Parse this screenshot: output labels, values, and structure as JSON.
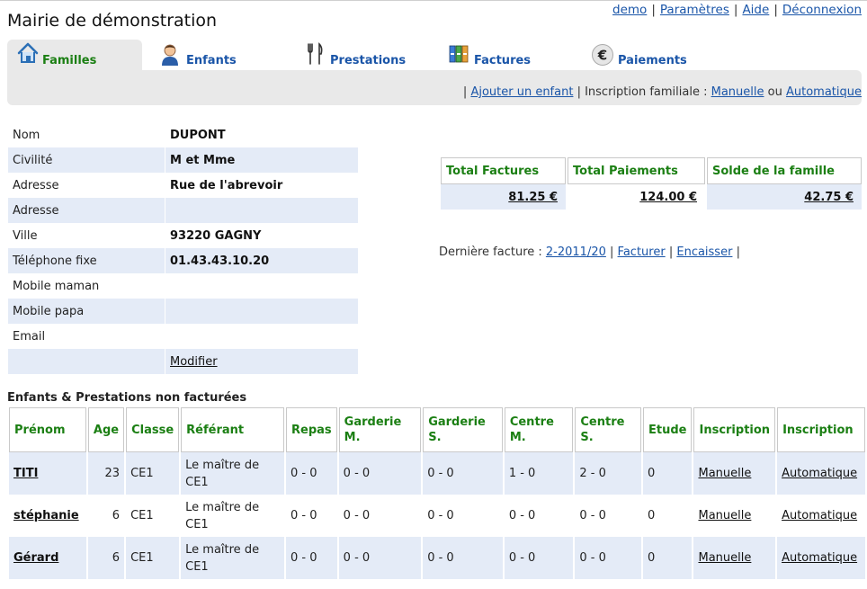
{
  "app": {
    "title": "Mairie de démonstration"
  },
  "top_links": [
    "demo",
    "Paramètres",
    "Aide",
    "Déconnexion"
  ],
  "tabs": [
    {
      "label": "Familles",
      "icon": "house-icon"
    },
    {
      "label": "Enfants",
      "icon": "child-icon"
    },
    {
      "label": "Prestations",
      "icon": "fork-knife-icon"
    },
    {
      "label": "Factures",
      "icon": "binders-icon"
    },
    {
      "label": "Paiements",
      "icon": "euro-icon"
    }
  ],
  "subbar": {
    "sep": "|",
    "add_child": "Ajouter un enfant",
    "family_signup": "| Inscription familiale :",
    "manual": "Manuelle",
    "or": "ou",
    "auto": "Automatique"
  },
  "family": {
    "rows": [
      {
        "label": "Nom",
        "value": "DUPONT"
      },
      {
        "label": "Civilité",
        "value": "M et Mme"
      },
      {
        "label": "Adresse",
        "value": "Rue de l'abrevoir"
      },
      {
        "label": "Adresse",
        "value": ""
      },
      {
        "label": "Ville",
        "value": "93220 GAGNY"
      },
      {
        "label": "Téléphone fixe",
        "value": "01.43.43.10.20"
      },
      {
        "label": "Mobile maman",
        "value": ""
      },
      {
        "label": "Mobile papa",
        "value": ""
      },
      {
        "label": "Email",
        "value": ""
      }
    ],
    "modify": "Modifier"
  },
  "totals": {
    "headers": [
      "Total Factures",
      "Total Paiements",
      "Solde de la famille"
    ],
    "values": [
      "81.25 €",
      "124.00 €",
      "42.75 €"
    ]
  },
  "last_invoice": {
    "label": "Dernière facture :",
    "number": "2-2011/20",
    "bill": "Facturer",
    "collect": "Encaisser",
    "sep": "|"
  },
  "children_section": {
    "title": "Enfants & Prestations non facturées",
    "headers": [
      "Prénom",
      "Age",
      "Classe",
      "Référant",
      "Repas",
      "Garderie M.",
      "Garderie S.",
      "Centre M.",
      "Centre S.",
      "Etude",
      "Inscription",
      "Inscription"
    ],
    "rows": [
      {
        "prenom": "TITI",
        "age": "23",
        "classe": "CE1",
        "referant": "Le maître de CE1",
        "repas": "0 - 0",
        "garderie_m": "0 - 0",
        "garderie_s": "0 - 0",
        "centre_m": "1 - 0",
        "centre_s": "2 - 0",
        "etude": "0",
        "insc_1": "Manuelle",
        "insc_2": "Automatique"
      },
      {
        "prenom": "stéphanie",
        "age": "6",
        "classe": "CE1",
        "referant": "Le maître de CE1",
        "repas": "0 - 0",
        "garderie_m": "0 - 0",
        "garderie_s": "0 - 0",
        "centre_m": "0 - 0",
        "centre_s": "0 - 0",
        "etude": "0",
        "insc_1": "Manuelle",
        "insc_2": "Automatique"
      },
      {
        "prenom": "Gérard",
        "age": "6",
        "classe": "CE1",
        "referant": "Le maître de CE1",
        "repas": "0 - 0",
        "garderie_m": "0 - 0",
        "garderie_s": "0 - 0",
        "centre_m": "0 - 0",
        "centre_s": "0 - 0",
        "etude": "0",
        "insc_1": "Manuelle",
        "insc_2": "Automatique"
      }
    ]
  },
  "colors": {
    "link": "#1a55a8",
    "header_green": "#1b7f13",
    "row_alt": "#e4ebf7",
    "tabbar": "#e9e9e9"
  }
}
